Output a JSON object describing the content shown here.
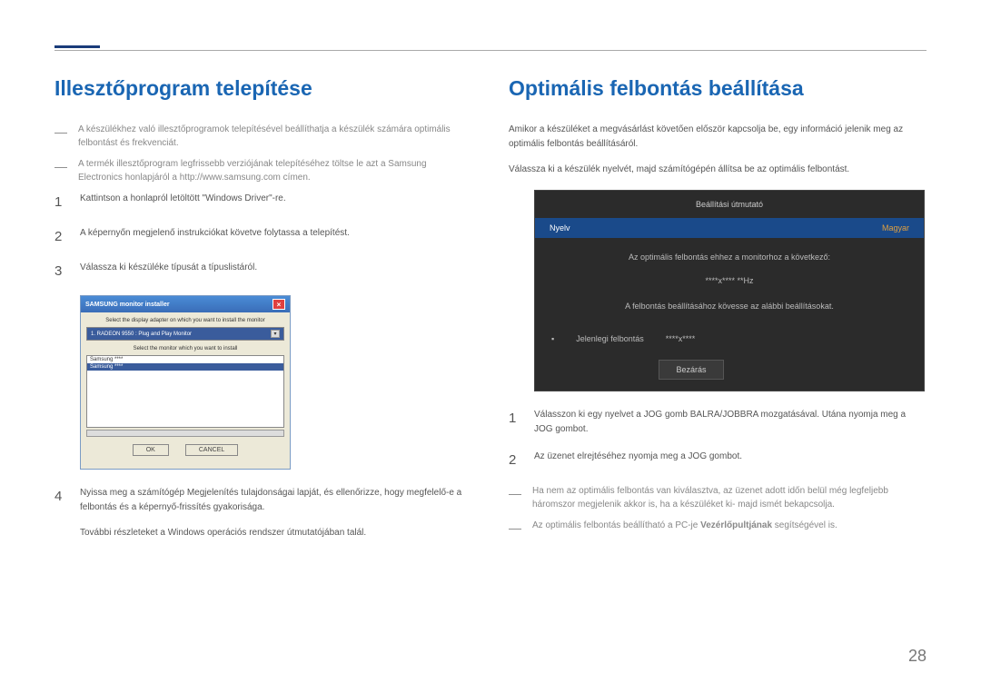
{
  "page_number": "28",
  "left": {
    "heading": "Illesztőprogram telepítése",
    "note1": "A készülékhez való illesztőprogramok telepítésével beállíthatja a készülék számára optimális felbontást és frekvenciát.",
    "note2": "A termék illesztőprogram legfrissebb verziójának telepítéséhez töltse le azt a Samsung Electronics honlapjáról a http://www.samsung.com címen.",
    "step1": "Kattintson a honlapról letöltött \"Windows Driver\"-re.",
    "step2": "A képernyőn megjelenő instrukciókat követve folytassa a telepítést.",
    "step3": "Válassza ki készüléke típusát a típuslistáról.",
    "step4": "Nyissa meg a számítógép Megjelenítés tulajdonságai lapját, és ellenőrizze, hogy megfelelő-e a felbontás és a képernyő-frissítés gyakorisága.",
    "step4_extra": "További részleteket a Windows operációs rendszer útmutatójában talál.",
    "installer": {
      "title": "SAMSUNG monitor installer",
      "label1": "Select the display adapter on which you want to install the monitor",
      "dropdown": "1. RADEON 9550 : Plug and Play Monitor",
      "label2": "Select the monitor which you want to install",
      "list_item1": "Samsung ****",
      "list_item2": "Samsung ****",
      "ok": "OK",
      "cancel": "CANCEL"
    }
  },
  "right": {
    "heading": "Optimális felbontás beállítása",
    "intro1": "Amikor a készüléket a megvásárlást követően először kapcsolja be, egy információ jelenik meg az optimális felbontás beállításáról.",
    "intro2": "Válassza ki a készülék nyelvét, majd számítógépén állítsa be az optimális felbontást.",
    "osd": {
      "title": "Beállítási útmutató",
      "lang_label": "Nyelv",
      "lang_value": "Magyar",
      "optimal_text": "Az optimális felbontás ehhez a monitorhoz a következő:",
      "resolution": "****x**** **Hz",
      "follow_text": "A felbontás beállításához kövesse az alábbi beállításokat.",
      "current_label": "Jelenlegi felbontás",
      "current_value": "****x****",
      "close": "Bezárás"
    },
    "step1": "Válasszon ki egy nyelvet a JOG gomb BALRA/JOBBRA mozgatásával. Utána nyomja meg a JOG gombot.",
    "step2": "Az üzenet elrejtéséhez nyomja meg a JOG gombot.",
    "note1": "Ha nem az optimális felbontás van kiválasztva, az üzenet adott időn belül még legfeljebb háromszor megjelenik akkor is, ha a készüléket ki- majd ismét bekapcsolja.",
    "note2_prefix": "Az optimális felbontás beállítható a PC-je ",
    "note2_bold": "Vezérlőpultjának",
    "note2_suffix": " segítségével is."
  }
}
